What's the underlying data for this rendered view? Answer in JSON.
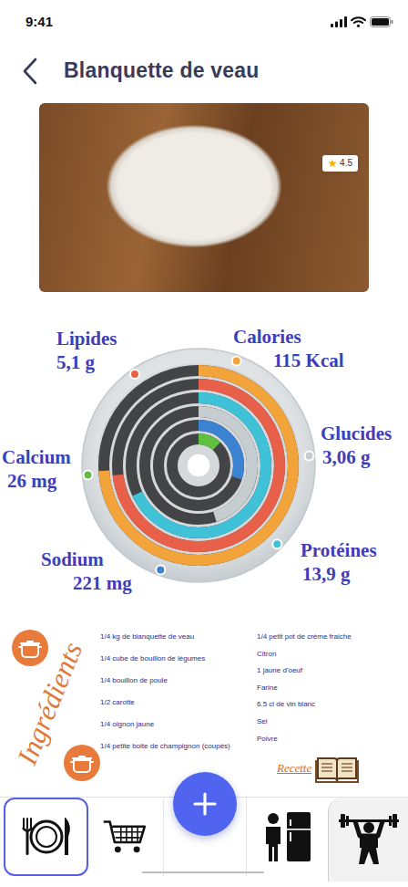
{
  "status_bar": {
    "time": "9:41"
  },
  "header": {
    "title": "Blanquette de veau"
  },
  "photo": {
    "rating": "4.5"
  },
  "nutrients": [
    {
      "label": "Calories",
      "value": "115 Kcal",
      "level": 0.74,
      "color": "#f2a33a"
    },
    {
      "label": "Lipides",
      "value": "5,1 g",
      "level": 0.73,
      "color": "#e8604a"
    },
    {
      "label": "Protéines",
      "value": "13,9 g",
      "level": 0.68,
      "color": "#3fc2d8"
    },
    {
      "label": "Glucides",
      "value": "3,06 g",
      "level": 0.45,
      "color": "#c6cdd1"
    },
    {
      "label": "Sodium",
      "value": "221 mg",
      "level": 0.3,
      "color": "#3b82d0"
    },
    {
      "label": "Calcium",
      "value": "26 mg",
      "level": 0.12,
      "color": "#5fc040"
    }
  ],
  "ingredients": {
    "title": "Ingrédients",
    "left": [
      "1/4 kg de blanquette de veau",
      "1/4 cube de bouillon de légumes",
      "1/4 bouillon de poule",
      "1/2 carotte",
      "1/4 oignon jaune",
      "1/4 petite boite de champignon (coupés)"
    ],
    "right": [
      "1/4 petit pot de crème fraiche",
      "Citron",
      "1 jaune d'oeuf",
      "Farine",
      "6.5 cl de vin blanc",
      "Sel",
      "Poivre"
    ]
  },
  "recipe": {
    "label": "Recette"
  },
  "nav": {
    "items": [
      {
        "kind": "plate",
        "selected": true
      },
      {
        "kind": "cart",
        "selected": false
      },
      {
        "kind": "add",
        "selected": false
      },
      {
        "kind": "fridge",
        "selected": false
      },
      {
        "kind": "fitness",
        "selected": false
      }
    ]
  }
}
